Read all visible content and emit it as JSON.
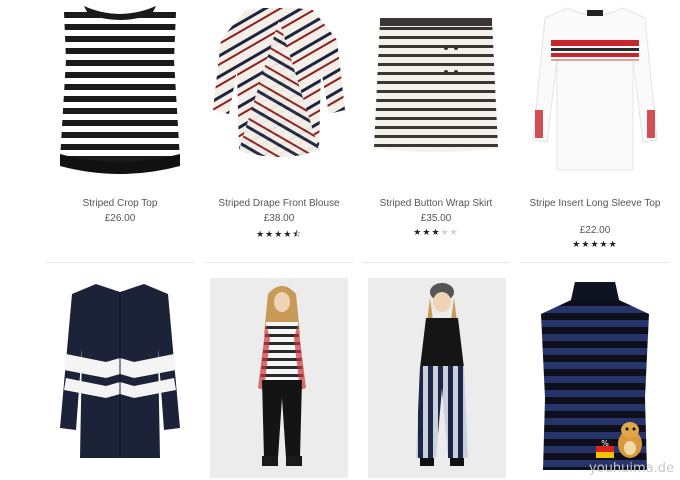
{
  "products_top": [
    {
      "name": "Striped Crop Top",
      "price": "£26.00",
      "rating": null
    },
    {
      "name": "Striped Drape Front Blouse",
      "price": "£38.00",
      "rating": 4.5
    },
    {
      "name": "Striped Button Wrap Skirt",
      "price": "£35.00",
      "rating": 3
    },
    {
      "name": "Stripe Insert Long Sleeve Top",
      "price": "£22.00",
      "rating": 5
    }
  ],
  "products_bottom": [
    {
      "name": "Navy striped shirt"
    },
    {
      "name": "Model in striped top"
    },
    {
      "name": "Model in striped trousers"
    },
    {
      "name": "Navy striped high neck top"
    }
  ],
  "watermark": "youhuima.de",
  "colors": {
    "background": "#ffffff",
    "text": "#555555",
    "star_on": "#222222",
    "star_off": "#d0d0d0",
    "navy": "#1c2238"
  }
}
